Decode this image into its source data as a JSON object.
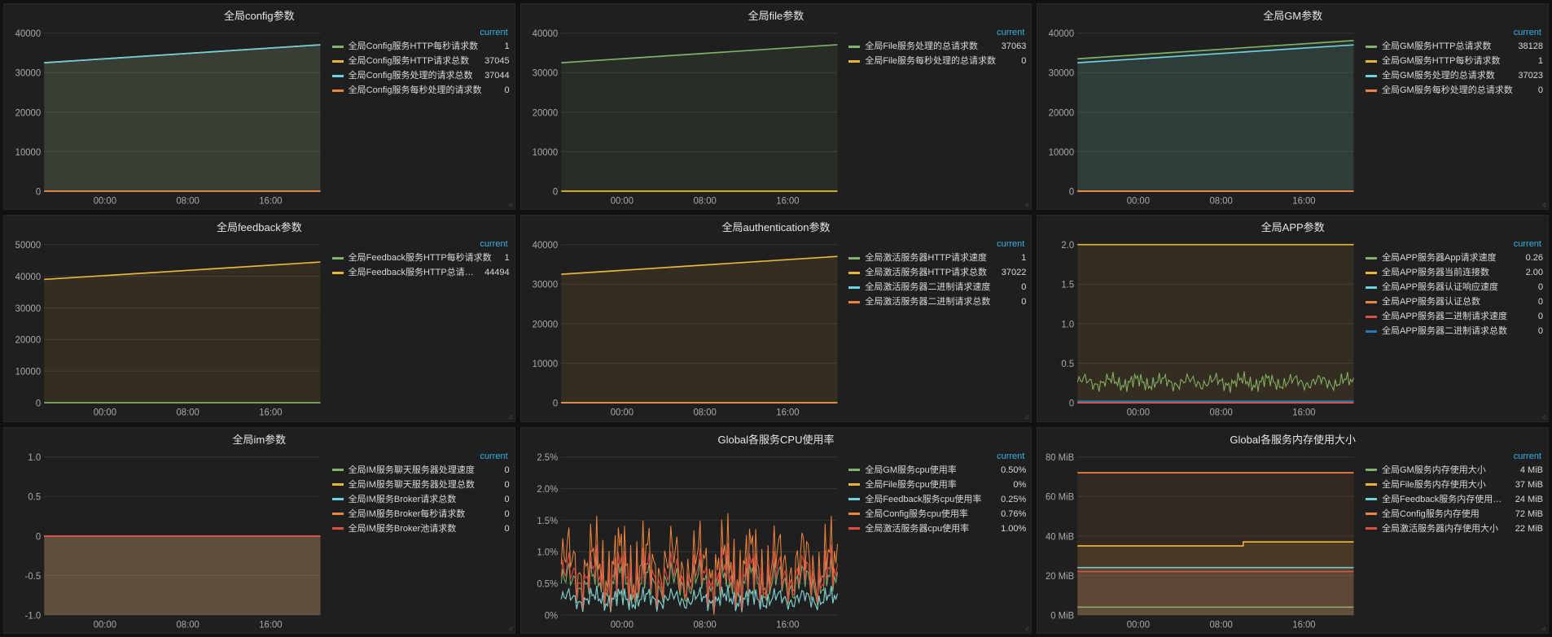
{
  "legend_header": "current",
  "x_ticks": [
    "00:00",
    "08:00",
    "16:00"
  ],
  "colors": {
    "green": "#7eb26d",
    "yellow": "#eab839",
    "teal": "#6ed0e0",
    "orange": "#ef843c",
    "red": "#e24d42",
    "blue": "#1f78c1"
  },
  "panels": [
    {
      "id": "config",
      "title": "全局config参数",
      "yticks": [
        "0",
        "10000",
        "20000",
        "30000",
        "40000"
      ],
      "legend": [
        {
          "color": "green",
          "label": "全局Config服务HTTP每秒请求数",
          "value": "1"
        },
        {
          "color": "yellow",
          "label": "全局Config服务HTTP请求总数",
          "value": "37045"
        },
        {
          "color": "teal",
          "label": "全局Config服务处理的请求总数",
          "value": "37044"
        },
        {
          "color": "orange",
          "label": "全局Config服务每秒处理的请求数",
          "value": "0"
        }
      ],
      "chart_data": {
        "type": "line",
        "x_range": [
          "19:00_prev",
          "18:00"
        ],
        "ylim": [
          0,
          40000
        ],
        "series": [
          {
            "name": "全局Config服务HTTP每秒请求数",
            "color": "green",
            "start": 1,
            "end": 1
          },
          {
            "name": "全局Config服务HTTP请求总数",
            "color": "yellow",
            "start": 32500,
            "end": 37045
          },
          {
            "name": "全局Config服务处理的请求总数",
            "color": "teal",
            "start": 32500,
            "end": 37044
          },
          {
            "name": "全局Config服务每秒处理的请求数",
            "color": "orange",
            "start": 0,
            "end": 0
          }
        ]
      }
    },
    {
      "id": "file",
      "title": "全局file参数",
      "yticks": [
        "0",
        "10000",
        "20000",
        "30000",
        "40000"
      ],
      "legend": [
        {
          "color": "green",
          "label": "全局File服务处理的总请求数",
          "value": "37063"
        },
        {
          "color": "yellow",
          "label": "全局File服务每秒处理的总请求数",
          "value": "0"
        }
      ],
      "chart_data": {
        "type": "line",
        "ylim": [
          0,
          40000
        ],
        "series": [
          {
            "name": "全局File服务处理的总请求数",
            "color": "green",
            "start": 32500,
            "end": 37063
          },
          {
            "name": "全局File服务每秒处理的总请求数",
            "color": "yellow",
            "start": 0,
            "end": 0
          }
        ]
      }
    },
    {
      "id": "gm",
      "title": "全局GM参数",
      "yticks": [
        "0",
        "10000",
        "20000",
        "30000",
        "40000"
      ],
      "legend": [
        {
          "color": "green",
          "label": "全局GM服务HTTP总请求数",
          "value": "38128"
        },
        {
          "color": "yellow",
          "label": "全局GM服务HTTP每秒请求数",
          "value": "1"
        },
        {
          "color": "teal",
          "label": "全局GM服务处理的总请求数",
          "value": "37023"
        },
        {
          "color": "orange",
          "label": "全局GM服务每秒处理的总请求数",
          "value": "0"
        }
      ],
      "chart_data": {
        "type": "line",
        "ylim": [
          0,
          40000
        ],
        "series": [
          {
            "name": "全局GM服务HTTP总请求数",
            "color": "green",
            "start": 33500,
            "end": 38128
          },
          {
            "name": "全局GM服务HTTP每秒请求数",
            "color": "yellow",
            "start": 1,
            "end": 1
          },
          {
            "name": "全局GM服务处理的总请求数",
            "color": "teal",
            "start": 32500,
            "end": 37023
          },
          {
            "name": "全局GM服务每秒处理的总请求数",
            "color": "orange",
            "start": 0,
            "end": 0
          }
        ]
      }
    },
    {
      "id": "feedback",
      "title": "全局feedback参数",
      "yticks": [
        "0",
        "10000",
        "20000",
        "30000",
        "40000",
        "50000"
      ],
      "legend": [
        {
          "color": "green",
          "label": "全局Feedback服务HTTP每秒请求数",
          "value": "1"
        },
        {
          "color": "yellow",
          "label": "全局Feedback服务HTTP总请求数",
          "value": "44494"
        }
      ],
      "chart_data": {
        "type": "line",
        "ylim": [
          0,
          50000
        ],
        "series": [
          {
            "name": "全局Feedback服务HTTP每秒请求数",
            "color": "green",
            "start": 1,
            "end": 1
          },
          {
            "name": "全局Feedback服务HTTP总请求数",
            "color": "yellow",
            "start": 39000,
            "end": 44494
          }
        ]
      }
    },
    {
      "id": "authentication",
      "title": "全局authentication参数",
      "yticks": [
        "0",
        "10000",
        "20000",
        "30000",
        "40000"
      ],
      "legend": [
        {
          "color": "green",
          "label": "全局激活服务器HTTP请求速度",
          "value": "1"
        },
        {
          "color": "yellow",
          "label": "全局激活服务器HTTP请求总数",
          "value": "37022"
        },
        {
          "color": "teal",
          "label": "全局激活服务器二进制请求速度",
          "value": "0"
        },
        {
          "color": "orange",
          "label": "全局激活服务器二进制请求总数",
          "value": "0"
        }
      ],
      "chart_data": {
        "type": "line",
        "ylim": [
          0,
          40000
        ],
        "series": [
          {
            "name": "全局激活服务器HTTP请求速度",
            "color": "green",
            "start": 1,
            "end": 1
          },
          {
            "name": "全局激活服务器HTTP请求总数",
            "color": "yellow",
            "start": 32500,
            "end": 37022
          },
          {
            "name": "全局激活服务器二进制请求速度",
            "color": "teal",
            "start": 0,
            "end": 0
          },
          {
            "name": "全局激活服务器二进制请求总数",
            "color": "orange",
            "start": 0,
            "end": 0
          }
        ]
      }
    },
    {
      "id": "app",
      "title": "全局APP参数",
      "yticks": [
        "0",
        "0.5",
        "1.0",
        "1.5",
        "2.0"
      ],
      "legend": [
        {
          "color": "green",
          "label": "全局APP服务器App请求速度",
          "value": "0.26"
        },
        {
          "color": "yellow",
          "label": "全局APP服务器当前连接数",
          "value": "2.00"
        },
        {
          "color": "teal",
          "label": "全局APP服务器认证响应速度",
          "value": "0"
        },
        {
          "color": "orange",
          "label": "全局APP服务器认证总数",
          "value": "0"
        },
        {
          "color": "red",
          "label": "全局APP服务器二进制请求速度",
          "value": "0"
        },
        {
          "color": "blue",
          "label": "全局APP服务器二进制请求总数",
          "value": "0"
        }
      ],
      "chart_data": {
        "type": "line",
        "ylim": [
          0,
          2.0
        ],
        "series": [
          {
            "name": "全局APP服务器App请求速度",
            "color": "green",
            "noisy_around": 0.26
          },
          {
            "name": "全局APP服务器当前连接数",
            "color": "yellow",
            "start": 2.0,
            "end": 2.0
          },
          {
            "name": "全局APP服务器认证响应速度",
            "color": "teal",
            "start": 0,
            "end": 0
          },
          {
            "name": "全局APP服务器认证总数",
            "color": "orange",
            "start": 0,
            "end": 0
          },
          {
            "name": "全局APP服务器二进制请求速度",
            "color": "red",
            "start": 0,
            "end": 0
          },
          {
            "name": "全局APP服务器二进制请求总数",
            "color": "blue",
            "start": 0.02,
            "end": 0.02
          }
        ]
      }
    },
    {
      "id": "im",
      "title": "全局im参数",
      "yticks": [
        "-1.0",
        "-0.5",
        "0",
        "0.5",
        "1.0"
      ],
      "legend": [
        {
          "color": "green",
          "label": "全局IM服务聊天服务器处理速度",
          "value": "0"
        },
        {
          "color": "yellow",
          "label": "全局IM服务聊天服务器处理总数",
          "value": "0"
        },
        {
          "color": "teal",
          "label": "全局IM服务Broker请求总数",
          "value": "0"
        },
        {
          "color": "orange",
          "label": "全局IM服务Broker每秒请求数",
          "value": "0"
        },
        {
          "color": "red",
          "label": "全局IM服务Broker池请求数",
          "value": "0"
        }
      ],
      "chart_data": {
        "type": "line",
        "ylim": [
          -1.0,
          1.0
        ],
        "series": [
          {
            "name": "全局IM服务聊天服务器处理速度",
            "color": "green",
            "start": 0,
            "end": 0
          },
          {
            "name": "全局IM服务聊天服务器处理总数",
            "color": "yellow",
            "start": 0,
            "end": 0
          },
          {
            "name": "全局IM服务Broker请求总数",
            "color": "teal",
            "start": 0,
            "end": 0
          },
          {
            "name": "全局IM服务Broker每秒请求数",
            "color": "orange",
            "start": 0,
            "end": 0
          },
          {
            "name": "全局IM服务Broker池请求数",
            "color": "red",
            "start": 0,
            "end": 0
          }
        ]
      }
    },
    {
      "id": "cpu",
      "title": "Global各服务CPU使用率",
      "yticks": [
        "0%",
        "0.5%",
        "1.0%",
        "1.5%",
        "2.0%",
        "2.5%"
      ],
      "legend": [
        {
          "color": "green",
          "label": "全局GM服务cpu使用率",
          "value": "0.50%"
        },
        {
          "color": "yellow",
          "label": "全局File服务cpu使用率",
          "value": "0%"
        },
        {
          "color": "teal",
          "label": "全局Feedback服务cpu使用率",
          "value": "0.25%"
        },
        {
          "color": "orange",
          "label": "全局Config服务cpu使用率",
          "value": "0.76%"
        },
        {
          "color": "red",
          "label": "全局激活服务器cpu使用率",
          "value": "1.00%"
        }
      ],
      "chart_data": {
        "type": "line",
        "ylim": [
          0,
          2.5
        ],
        "noisy": true,
        "series": [
          {
            "name": "全局GM服务cpu使用率",
            "color": "green",
            "noisy_around": 0.5,
            "spread": 0.5
          },
          {
            "name": "全局File服务cpu使用率",
            "color": "yellow",
            "noisy_around": 0.25,
            "spread": 0.25
          },
          {
            "name": "全局Feedback服务cpu使用率",
            "color": "teal",
            "noisy_around": 0.25,
            "spread": 0.25
          },
          {
            "name": "全局Config服务cpu使用率",
            "color": "orange",
            "noisy_around": 0.8,
            "spread": 0.9
          },
          {
            "name": "全局激活服务器cpu使用率",
            "color": "red",
            "noisy_around": 0.6,
            "spread": 0.6
          }
        ]
      }
    },
    {
      "id": "mem",
      "title": "Global各服务内存使用大小",
      "yticks": [
        "0 MiB",
        "20 MiB",
        "40 MiB",
        "60 MiB",
        "80 MiB"
      ],
      "legend": [
        {
          "color": "green",
          "label": "全局GM服务内存使用大小",
          "value": "4 MiB"
        },
        {
          "color": "yellow",
          "label": "全局File服务内存使用大小",
          "value": "37 MiB"
        },
        {
          "color": "teal",
          "label": "全局Feedback服务内存使用大小",
          "value": "24 MiB"
        },
        {
          "color": "orange",
          "label": "全局Config服务内存使用",
          "value": "72 MiB"
        },
        {
          "color": "red",
          "label": "全局激活服务器内存使用大小",
          "value": "22 MiB"
        }
      ],
      "chart_data": {
        "type": "line",
        "ylim": [
          0,
          80
        ],
        "series": [
          {
            "name": "全局GM服务内存使用大小",
            "color": "green",
            "start": 4,
            "end": 4
          },
          {
            "name": "全局File服务内存使用大小",
            "color": "yellow",
            "start": 35,
            "end": 37,
            "step_at": 0.6,
            "step_to": 37
          },
          {
            "name": "全局Feedback服务内存使用大小",
            "color": "teal",
            "start": 24,
            "end": 24
          },
          {
            "name": "全局Config服务内存使用",
            "color": "orange",
            "start": 72,
            "end": 72
          },
          {
            "name": "全局激活服务器内存使用大小",
            "color": "red",
            "start": 22,
            "end": 22
          }
        ]
      }
    }
  ]
}
